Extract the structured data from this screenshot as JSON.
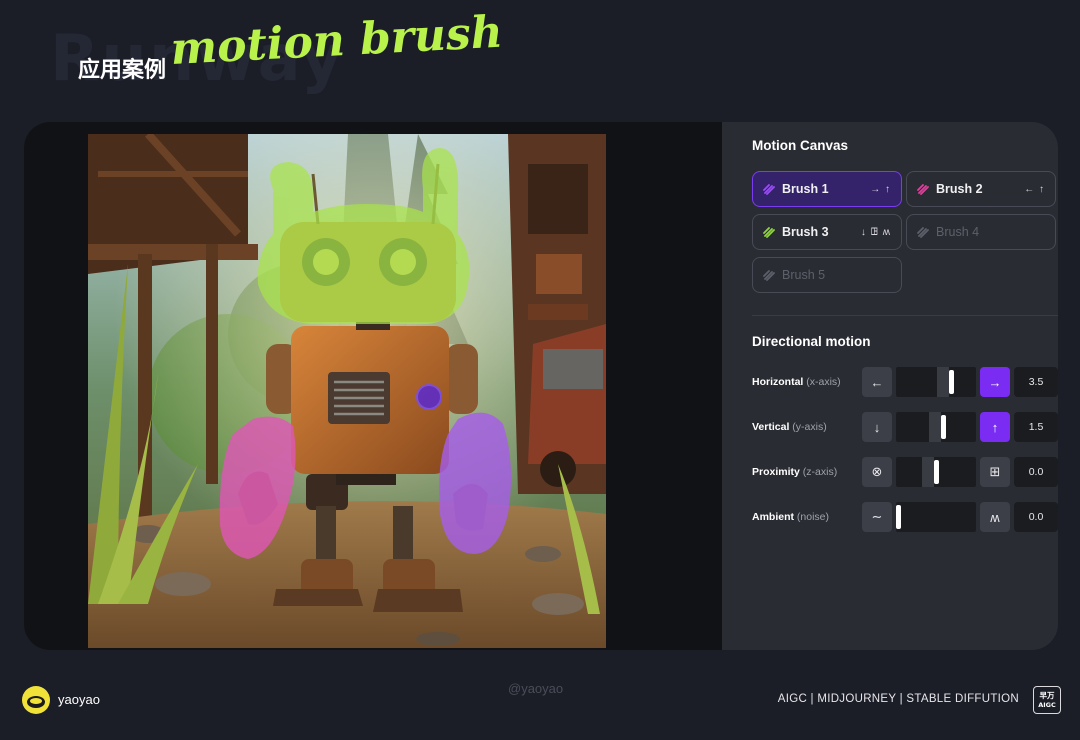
{
  "header": {
    "bg_word": "Runway",
    "title_cn": "应用案例",
    "title_en": "motion brush"
  },
  "panel": {
    "motion_canvas_title": "Motion Canvas",
    "brushes": [
      {
        "label": "Brush 1",
        "dirs": "→ ↑",
        "color": "#9a4df5"
      },
      {
        "label": "Brush 2",
        "dirs": "← ↑",
        "color": "#e0409c"
      },
      {
        "label": "Brush 3",
        "dirs": "↓ ꖸ ʍ",
        "color": "#8ed63a"
      },
      {
        "label": "Brush 4",
        "dirs": "",
        "color": "#5d606a"
      },
      {
        "label": "Brush 5",
        "dirs": "",
        "color": "#5d606a"
      }
    ],
    "directional_title": "Directional motion",
    "controls": [
      {
        "name": "Horizontal",
        "axis": "(x-axis)",
        "minus_icon": "←",
        "plus_icon": "→",
        "value": "3.5",
        "level": 0.7
      },
      {
        "name": "Vertical",
        "axis": "(y-axis)",
        "minus_icon": "↓",
        "plus_icon": "↑",
        "value": "1.5",
        "level": 0.6
      },
      {
        "name": "Proximity",
        "axis": "(z-axis)",
        "minus_icon": "⊗",
        "plus_icon": "⊞",
        "value": "0.0",
        "level": 0.5
      },
      {
        "name": "Ambient",
        "axis": "(noise)",
        "minus_icon": "∼",
        "plus_icon": "ʍ",
        "value": "0.0",
        "level": 0.0
      }
    ]
  },
  "footer": {
    "author": "yaoyao",
    "watermark": "@yaoyao",
    "tags": "AIGC | MIDJOURNEY | STABLE DIFFUTION",
    "badge_top": "早万",
    "badge_bottom": "AIGC"
  },
  "colors": {
    "accent": "#7a2cf2",
    "title_green": "#b8f24a",
    "background": "#1b1d27"
  }
}
